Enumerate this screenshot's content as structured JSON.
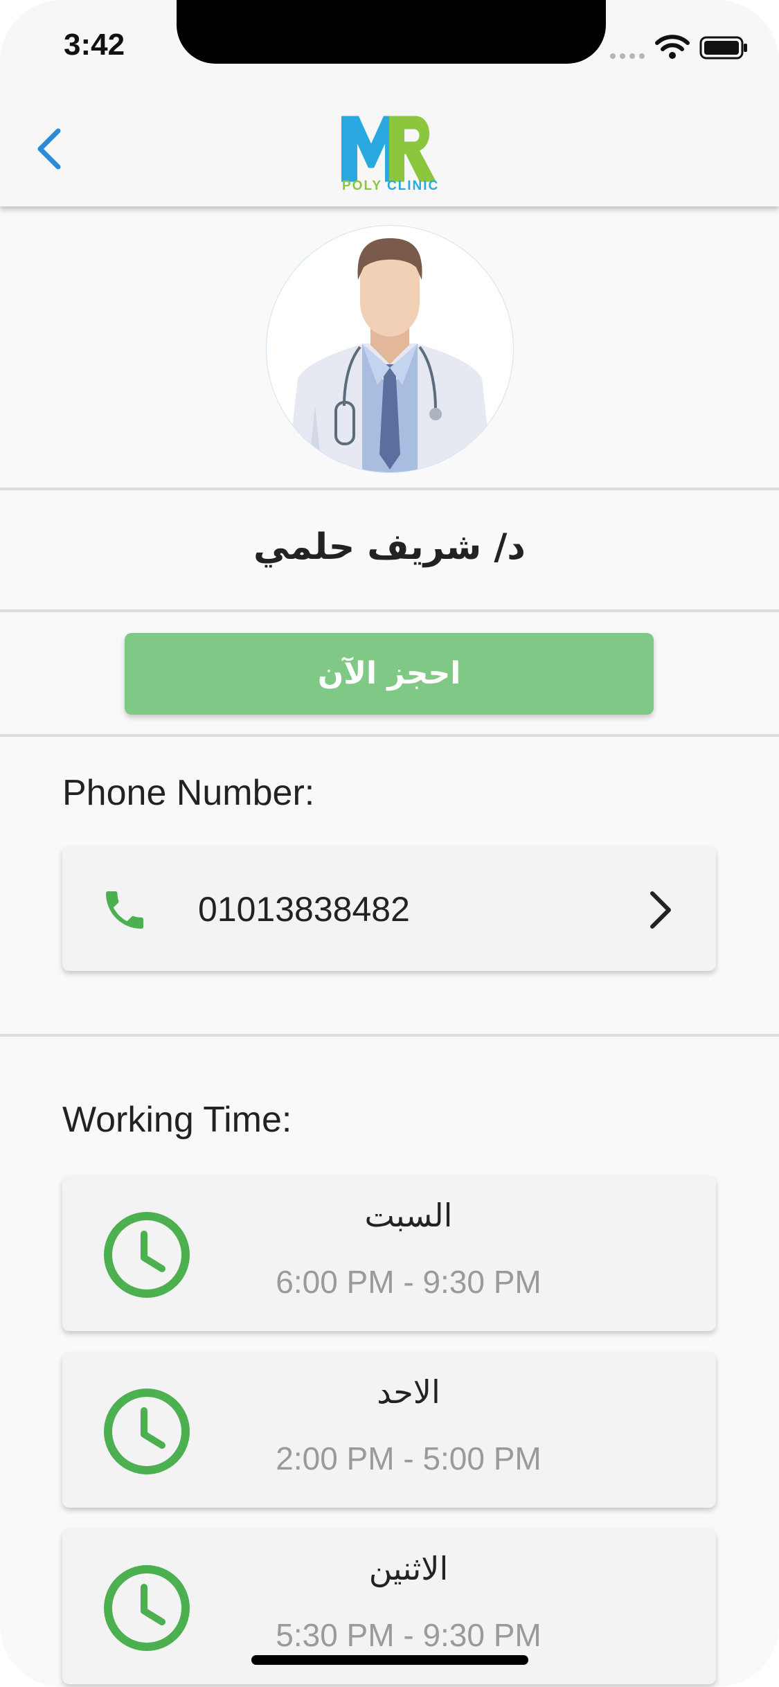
{
  "status_bar": {
    "time": "3:42"
  },
  "navbar": {
    "logo_text": "MR",
    "logo_subtitle_poly": "POLY",
    "logo_subtitle_clinic": "CLINIC",
    "back_icon": "chevron-left-icon"
  },
  "colors": {
    "accent_blue": "#2b8bd8",
    "logo_blue": "#29a9e0",
    "logo_green": "#8cc63f",
    "book_green": "#80c886",
    "icon_green": "#4caf50"
  },
  "doctor": {
    "name": "د/ شريف حلمي",
    "book_label": "احجز الآن"
  },
  "phone": {
    "title": "Phone Number:",
    "number": "01013838482",
    "icon": "phone-icon"
  },
  "working_time": {
    "title": "Working Time:",
    "items": [
      {
        "day": "السبت",
        "hours": "6:00 PM - 9:30 PM"
      },
      {
        "day": "الاحد",
        "hours": "2:00 PM - 5:00 PM"
      },
      {
        "day": "الاثنين",
        "hours": "5:30 PM - 9:30 PM"
      }
    ]
  }
}
